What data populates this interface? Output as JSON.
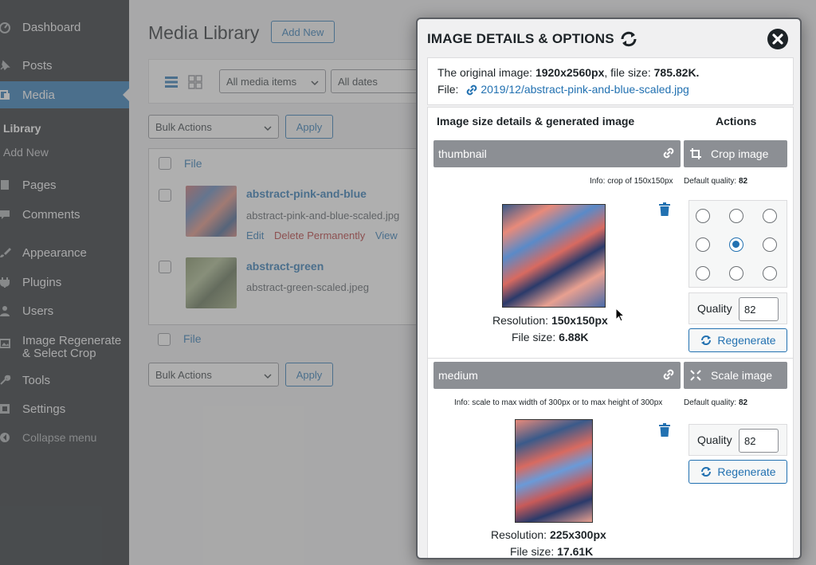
{
  "sidebar": {
    "items": [
      {
        "label": "Dashboard",
        "icon": "dashboard-icon"
      },
      {
        "label": "Posts",
        "icon": "pin-icon"
      },
      {
        "label": "Media",
        "icon": "media-icon"
      },
      {
        "label": "Pages",
        "icon": "pages-icon"
      },
      {
        "label": "Comments",
        "icon": "comments-icon"
      },
      {
        "label": "Appearance",
        "icon": "brush-icon"
      },
      {
        "label": "Plugins",
        "icon": "plugin-icon"
      },
      {
        "label": "Users",
        "icon": "users-icon"
      },
      {
        "label": "Image Regenerate",
        "label2": "& Select Crop",
        "icon": "image-icon"
      },
      {
        "label": "Tools",
        "icon": "wrench-icon"
      },
      {
        "label": "Settings",
        "icon": "settings-icon"
      },
      {
        "label": "Collapse menu",
        "icon": "collapse-icon"
      }
    ],
    "sub": {
      "library": "Library",
      "add_new": "Add New"
    }
  },
  "page": {
    "title": "Media Library",
    "add_new": "Add New",
    "filter_media": "All media items",
    "filter_dates": "All dates",
    "bulk_actions": "Bulk Actions",
    "apply": "Apply",
    "col_file": "File",
    "rows": [
      {
        "title": "abstract-pink-and-blue",
        "file": "abstract-pink-and-blue-scaled.jpg",
        "actions": [
          "Edit",
          "Delete Permanently",
          "View"
        ]
      },
      {
        "title": "abstract-green",
        "file": "abstract-green-scaled.jpeg"
      }
    ]
  },
  "modal": {
    "title": "IMAGE DETAILS & OPTIONS",
    "original_prefix": "The original image: ",
    "original_dims": "1920x2560px",
    "original_mid": ", file size: ",
    "original_size": "785.82K.",
    "file_label": "File:",
    "file_path": "2019/12/abstract-pink-and-blue-scaled.jpg",
    "col_details": "Image size details & generated image",
    "col_actions": "Actions",
    "sizes": [
      {
        "name": "thumbnail",
        "action": "Crop image",
        "info_prefix": "Info: ",
        "info_text": "crop of 150x150px",
        "quality_label": "Default quality: ",
        "quality_value": "82",
        "resolution_label": "Resolution: ",
        "resolution": "150x150px",
        "filesize_label": "File size: ",
        "filesize": "6.88K",
        "quality_field_label": "Quality",
        "quality_field_value": "82",
        "regenerate": "Regenerate",
        "crop_position": "center"
      },
      {
        "name": "medium",
        "action": "Scale image",
        "info_prefix": "Info: ",
        "info_text": "scale to max width of 300px or to max height of 300px",
        "quality_label": "Default quality: ",
        "quality_value": "82",
        "resolution_label": "Resolution: ",
        "resolution": "225x300px",
        "filesize_label": "File size: ",
        "filesize": "17.61K",
        "quality_field_label": "Quality",
        "quality_field_value": "82",
        "regenerate": "Regenerate"
      }
    ]
  },
  "colors": {
    "accent": "#2271b1",
    "sidebar": "#1d2327",
    "delete": "#b32d2e"
  }
}
